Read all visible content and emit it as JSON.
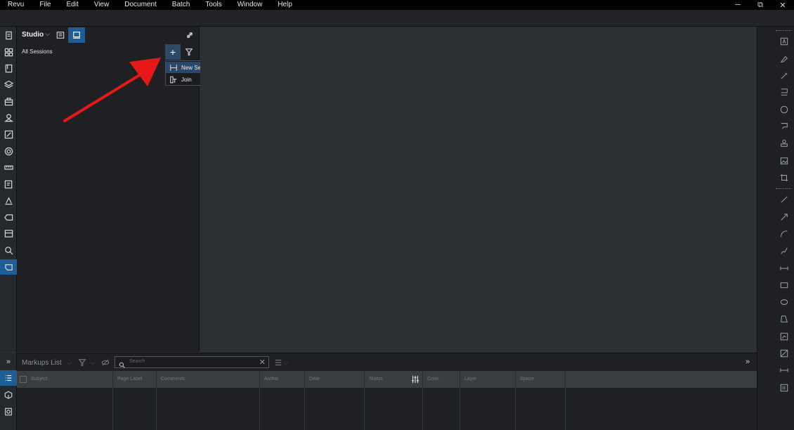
{
  "menu": [
    "Revu",
    "File",
    "Edit",
    "View",
    "Document",
    "Batch",
    "Tools",
    "Window",
    "Help"
  ],
  "window_controls": {
    "minimize": "─",
    "restore": "⧉",
    "close": "✕"
  },
  "studio": {
    "title": "Studio",
    "chevron": "⌵",
    "all_sessions_label": "All Sessions",
    "add_label": "+"
  },
  "dropdown": {
    "items": [
      {
        "label": "New Session",
        "icon": "new-session-icon"
      },
      {
        "label": "Join",
        "icon": "join-icon"
      }
    ]
  },
  "markups": {
    "title": "Markups List",
    "chevron": "⌵",
    "search_placeholder": "Search",
    "clear": "✕",
    "columns": [
      "Subject",
      "Page Label",
      "Comments",
      "Author",
      "Date",
      "Status",
      "Color",
      "Layer",
      "Space"
    ]
  },
  "expand_glyph": "»",
  "colors": {
    "accent": "#1f5d96",
    "menubar": "#000000",
    "panel": "#1e2023",
    "canvas": "#2c2f33",
    "annotation_arrow": "#e51919"
  }
}
